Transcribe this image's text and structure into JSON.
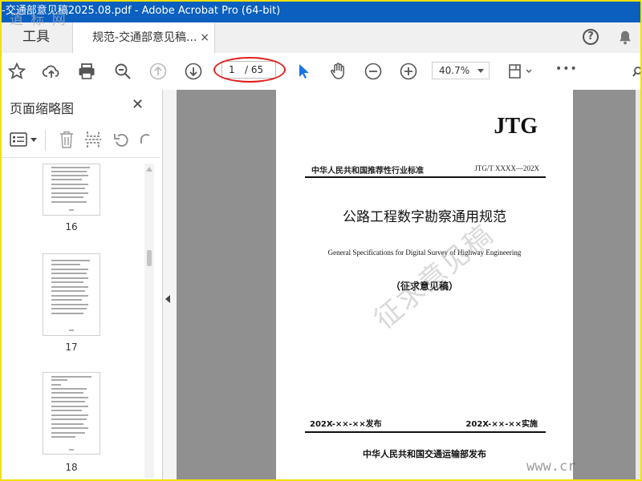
{
  "window": {
    "title": "-交通部意见稿2025.08.pdf - Adobe Acrobat Pro (64-bit)",
    "watermark_top": "道 标 网"
  },
  "tabs": {
    "tools_label": "工具",
    "doc_label": "规范-交通部意见稿...",
    "doc_close": "×",
    "help_symbol": "?"
  },
  "toolbar": {
    "current_page": "1",
    "total_pages": "/ 65",
    "zoom": "40.7%",
    "more": "•••"
  },
  "panel": {
    "title": "页面缩略图",
    "close": "✕",
    "thumbnails": [
      {
        "label": "16"
      },
      {
        "label": "17"
      },
      {
        "label": "18"
      }
    ]
  },
  "document": {
    "logo": "JTG",
    "header_left": "中华人民共和国推荐性行业标准",
    "header_right": "JTG/T XXXX—202X",
    "title_cn": "公路工程数字勘察通用规范",
    "title_en": "General Specifications for Digital Survey of Highway Engineering",
    "draft_label": "（征求意见稿）",
    "stamp_text": "征求意见稿",
    "date_issue": "202X-××-××发布",
    "date_effective": "202X-××-××实施",
    "publisher": "中华人民共和国交通运输部发布",
    "watermark_bottom": "www.cr"
  },
  "colors": {
    "titlebar": "#0a5fbf",
    "annotation_ellipse": "#e02020",
    "frame_border": "#f2e100",
    "select_tool": "#1a73e8"
  }
}
